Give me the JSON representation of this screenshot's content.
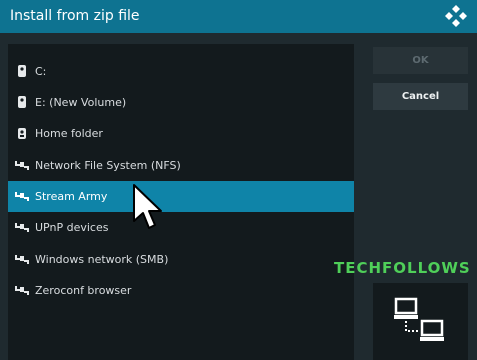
{
  "window": {
    "title": "Install from zip file",
    "icons": {
      "logo": "kodi-logo-icon"
    }
  },
  "list": {
    "items": [
      {
        "label": "C:",
        "icon": "drive-icon"
      },
      {
        "label": "E: (New Volume)",
        "icon": "drive-icon"
      },
      {
        "label": "Home folder",
        "icon": "home-folder-icon"
      },
      {
        "label": "Network File System (NFS)",
        "icon": "network-icon"
      },
      {
        "label": "Stream Army",
        "icon": "network-icon",
        "selected": true
      },
      {
        "label": "UPnP devices",
        "icon": "network-icon"
      },
      {
        "label": "Windows network (SMB)",
        "icon": "network-icon"
      },
      {
        "label": "Zeroconf browser",
        "icon": "network-icon"
      }
    ]
  },
  "buttons": {
    "ok_label": "OK",
    "cancel_label": "Cancel"
  },
  "watermark": "TECHFOLLOWS",
  "side_tile": {
    "icon": "network-computers-icon"
  },
  "colors": {
    "accent": "#0e7391",
    "selection": "#0f84a8",
    "panel": "#131a1d",
    "dialog": "#1f2a2f",
    "watermark": "#4fcf59"
  }
}
